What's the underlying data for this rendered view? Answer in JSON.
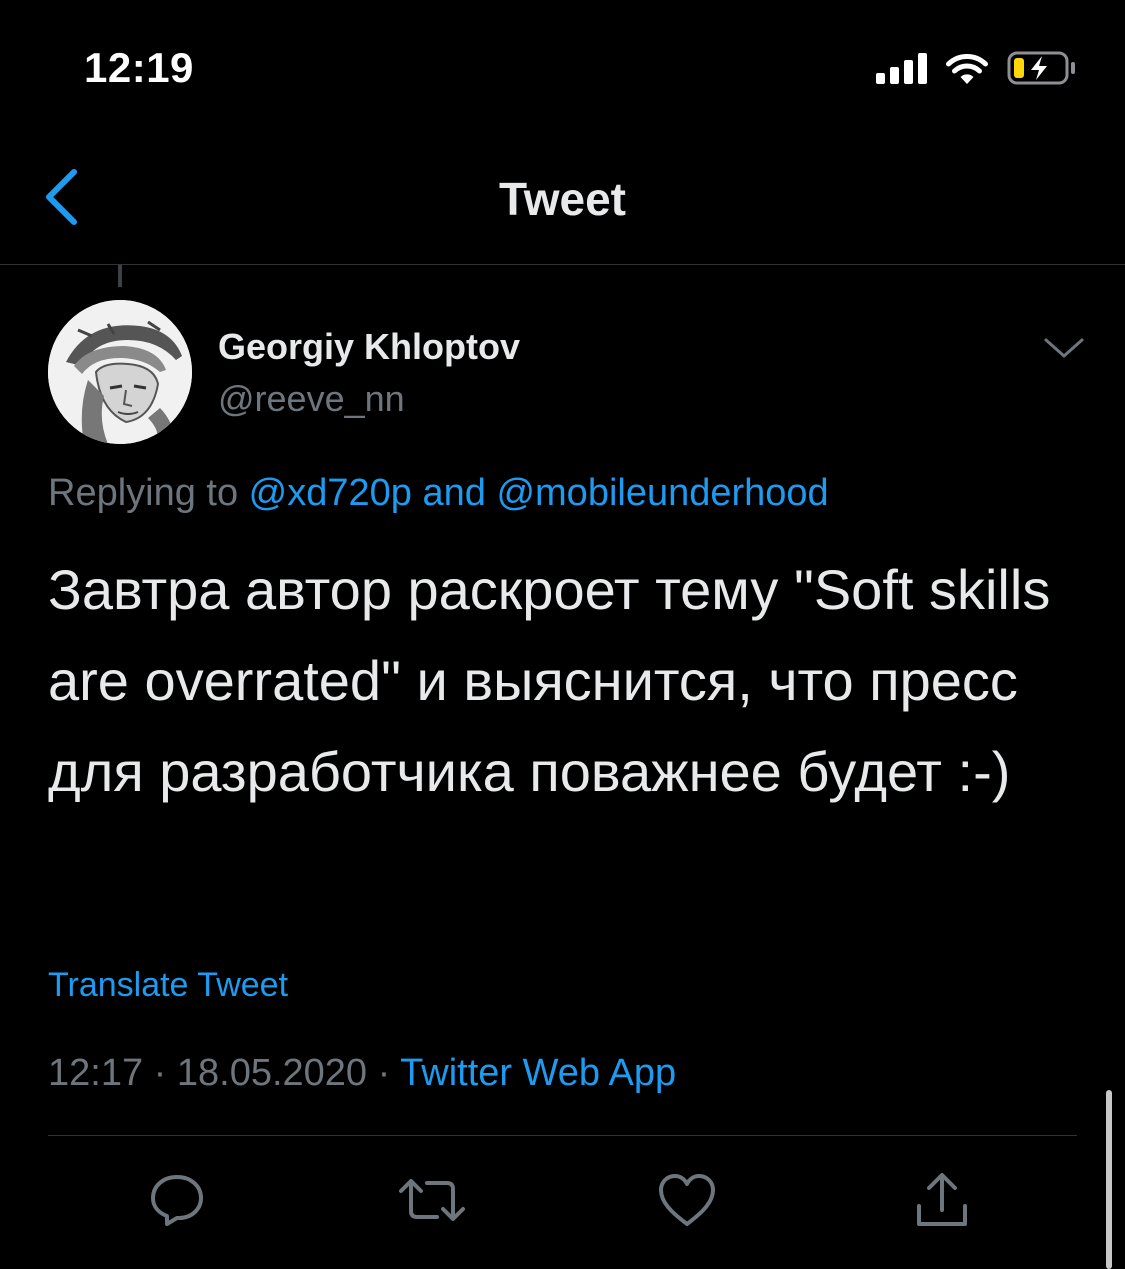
{
  "status_bar": {
    "time": "12:19"
  },
  "nav": {
    "title": "Tweet"
  },
  "tweet": {
    "author_name": "Georgiy Khloptov",
    "author_handle": "@reeve_nn",
    "replying_prefix": "Replying to ",
    "replying_user1": "@xd720p",
    "replying_and": " and ",
    "replying_user2": "@mobileunderhood",
    "text": "Завтра автор раскроет тему \"Soft skills are overrated\" и выяснится, что пресс для разработчика поважнее будет :-)",
    "translate_label": "Translate Tweet",
    "time": "12:17",
    "date": "18.05.2020",
    "source": "Twitter Web App",
    "separator": " · "
  },
  "colors": {
    "background": "#000000",
    "accent": "#1d9bf0",
    "text_primary": "#e7e9ea",
    "text_secondary": "#6e767d",
    "border": "#2f3336",
    "battery_charge": "#ffd60a"
  },
  "icons": {
    "back": "chevron-left-icon",
    "more": "chevron-down-icon",
    "reply": "comment-icon",
    "retweet": "retweet-icon",
    "like": "heart-icon",
    "share": "share-icon"
  }
}
